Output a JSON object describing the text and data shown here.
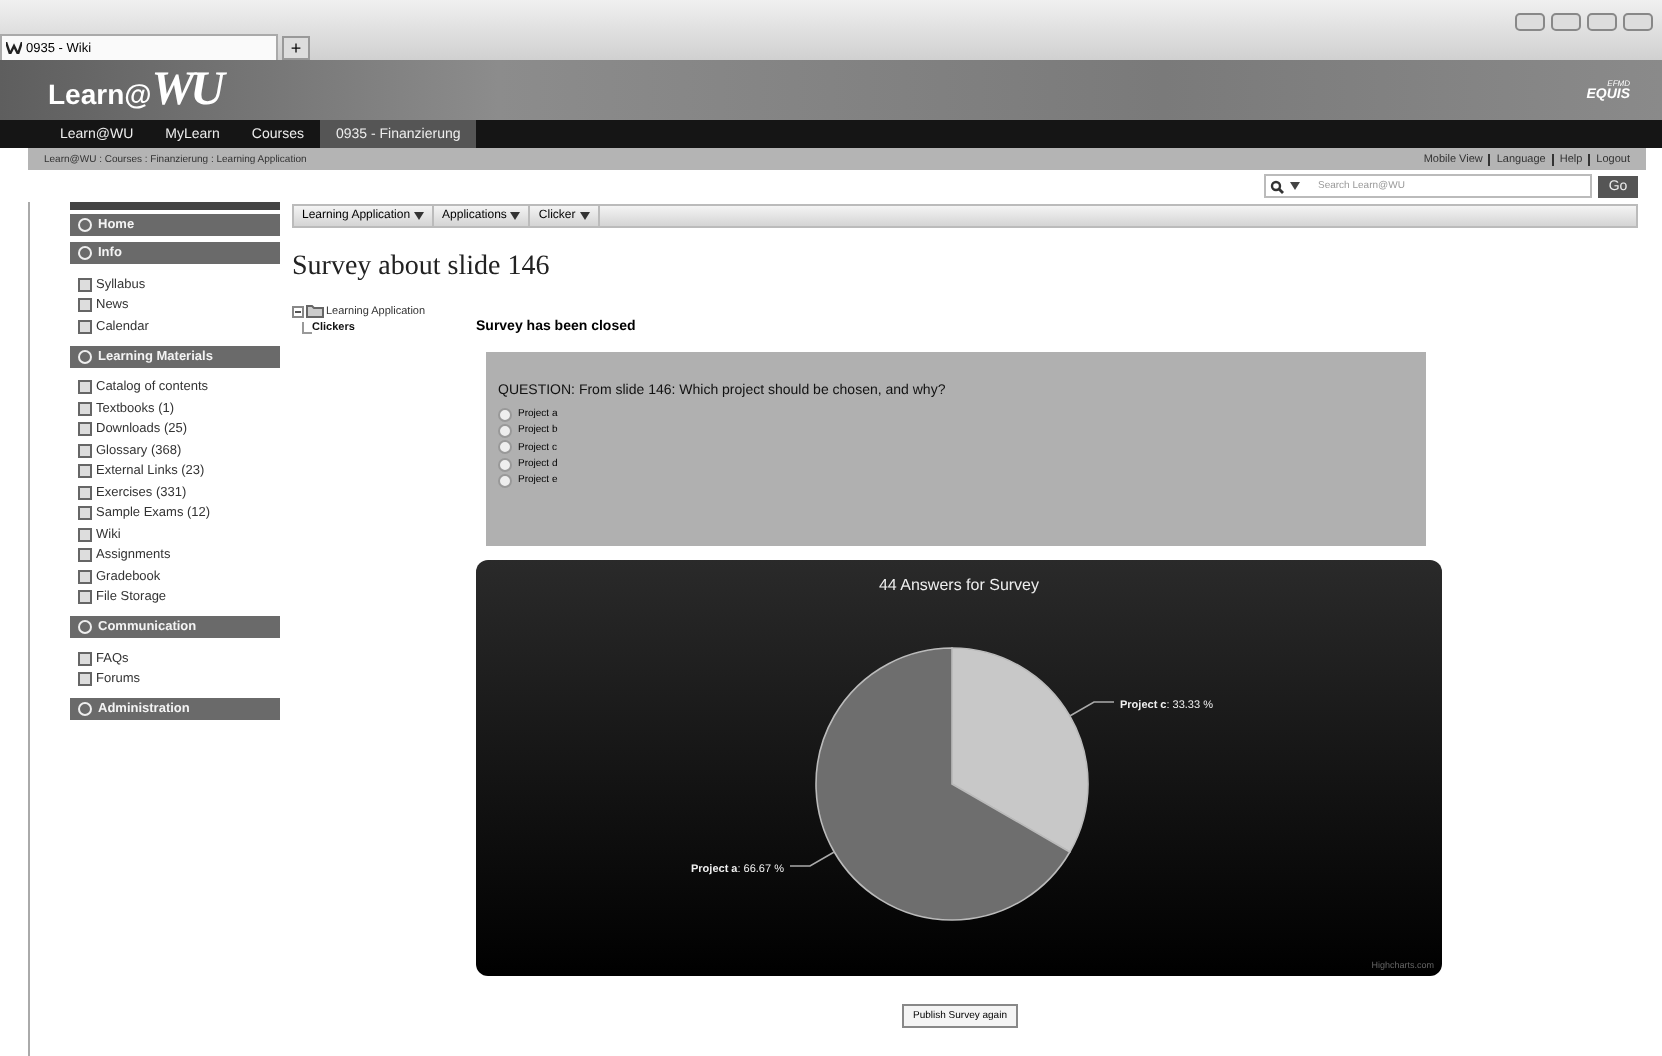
{
  "browser": {
    "tab_title": "0935 - Wiki",
    "new_tab": "+"
  },
  "header": {
    "logo_prefix": "Learn@",
    "logo_mark": "WU",
    "badge_top": "EFMD",
    "badge_main": "EQUIS"
  },
  "nav": [
    {
      "label": "Learn@WU",
      "selected": false
    },
    {
      "label": "MyLearn",
      "selected": false
    },
    {
      "label": "Courses",
      "selected": false
    },
    {
      "label": "0935 - Finanzierung",
      "selected": true
    }
  ],
  "breadcrumb": "Learn@WU : Courses : Finanzierung : Learning Application",
  "top_links": [
    "Mobile View",
    "Language",
    "Help",
    "Logout"
  ],
  "search": {
    "placeholder": "Search Learn@WU",
    "button": "Go"
  },
  "sidebar": [
    {
      "title": "Home"
    },
    {
      "title": "Info",
      "items": [
        "Syllabus",
        "News",
        "Calendar"
      ]
    },
    {
      "title": "Learning Materials",
      "items": [
        "Catalog of contents",
        "Textbooks (1)",
        "Downloads (25)",
        "Glossary (368)",
        "External Links (23)",
        "Exercises (331)",
        "Sample Exams (12)",
        "Wiki",
        "Assignments",
        "Gradebook",
        "File Storage"
      ]
    },
    {
      "title": "Communication",
      "items": [
        "FAQs",
        "Forums"
      ]
    },
    {
      "title": "Administration"
    }
  ],
  "toolbar": [
    "Learning Application",
    "Applications",
    "Clicker"
  ],
  "page_title": "Survey about slide 146",
  "tree": {
    "label": "Learning Application",
    "children": [
      {
        "label": "Clickers",
        "selected": true
      }
    ]
  },
  "status": "Survey has been closed",
  "question": {
    "text": "QUESTION: From slide 146: Which project should be chosen, and why?",
    "options": [
      {
        "label": "Project a",
        "selected": false
      },
      {
        "label": "Project b",
        "selected": false
      },
      {
        "label": "Project c",
        "selected": false
      },
      {
        "label": "Project d",
        "selected": false
      },
      {
        "label": "Project e",
        "selected": false
      }
    ]
  },
  "chart": {
    "credit": "Highcharts.com",
    "chart_data": {
      "type": "pie",
      "title": "44 Answers for Survey",
      "categories": [
        "Project c",
        "Project a"
      ],
      "values": [
        33.33,
        66.67
      ],
      "colors": [
        "#c8c8c8",
        "#6e6e6e"
      ],
      "value_labels": [
        ": 33.33 %",
        ": 66.67 %"
      ],
      "data_labels": true
    }
  },
  "publish_button": "Publish Survey again"
}
